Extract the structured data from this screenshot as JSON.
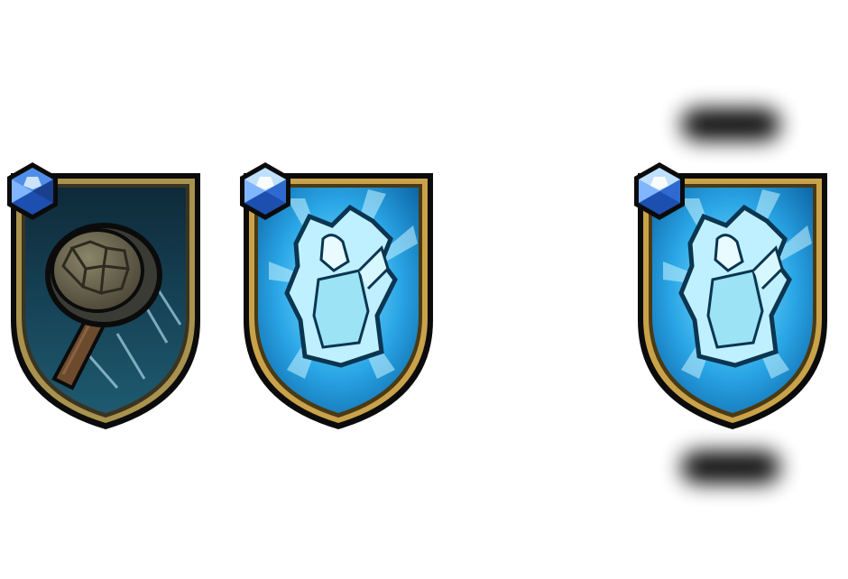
{
  "badges": [
    {
      "name": "hammer-skill",
      "icon": "stone-hammer-icon",
      "gem": "sapphire-gem-icon",
      "colors": {
        "frame_outer": "#0b0b0b",
        "frame_gold": "#a8924e",
        "bg_top": "#0e2a3a",
        "bg_bottom": "#1e5a70",
        "handle": "#6b4a2e",
        "stone": "#6f6a55"
      }
    },
    {
      "name": "ice-statue-skill",
      "icon": "ice-figure-icon",
      "gem": "sapphire-gem-icon",
      "colors": {
        "frame_outer": "#0b0b0b",
        "frame_gold": "#c9a24a",
        "bg_top": "#0a6fb2",
        "bg_bottom": "#47c6f2",
        "ice": "#bff0ff"
      }
    },
    {
      "name": "ice-statue-skill-selected",
      "icon": "ice-figure-icon",
      "gem": "sapphire-gem-icon",
      "colors": {
        "frame_outer": "#0b0b0b",
        "frame_gold": "#c9a24a",
        "bg_top": "#0a6fb2",
        "bg_bottom": "#47c6f2",
        "ice": "#bff0ff"
      }
    }
  ],
  "selection_indicator": {
    "icon": "shadow-bar-icon",
    "color": "#000000"
  }
}
